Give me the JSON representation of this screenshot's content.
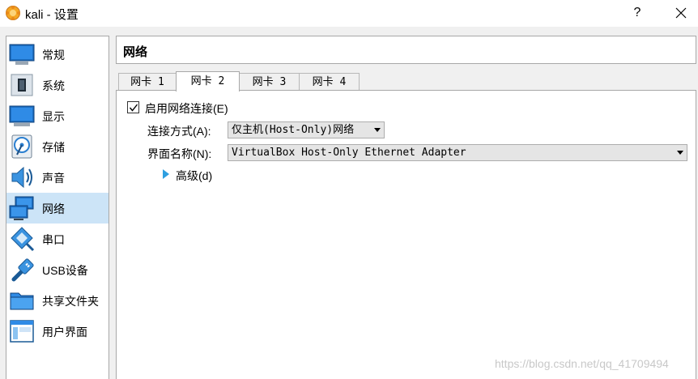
{
  "window": {
    "title": "kali - 设置",
    "help_glyph": "?",
    "app_icon": "virtualbox-icon"
  },
  "sidebar": {
    "items": [
      {
        "label": "常规",
        "icon": "general-monitor-icon",
        "selected": false
      },
      {
        "label": "系统",
        "icon": "system-chip-icon",
        "selected": false
      },
      {
        "label": "显示",
        "icon": "display-monitor-icon",
        "selected": false
      },
      {
        "label": "存储",
        "icon": "storage-disk-icon",
        "selected": false
      },
      {
        "label": "声音",
        "icon": "audio-speaker-icon",
        "selected": false
      },
      {
        "label": "网络",
        "icon": "network-icon",
        "selected": true
      },
      {
        "label": "串口",
        "icon": "serial-port-icon",
        "selected": false
      },
      {
        "label": "USB设备",
        "icon": "usb-icon",
        "selected": false
      },
      {
        "label": "共享文件夹",
        "icon": "shared-folder-icon",
        "selected": false
      },
      {
        "label": "用户界面",
        "icon": "user-interface-icon",
        "selected": false
      }
    ]
  },
  "header": {
    "title": "网络"
  },
  "tabs": [
    {
      "label": "网卡 1",
      "active": false
    },
    {
      "label": "网卡 2",
      "active": true
    },
    {
      "label": "网卡 3",
      "active": false
    },
    {
      "label": "网卡 4",
      "active": false
    }
  ],
  "adapter": {
    "enable_label": "启用网络连接(E)",
    "enabled": true,
    "attached_label": "连接方式(A):",
    "attached_value": "仅主机(Host-Only)网络",
    "name_label": "界面名称(N):",
    "name_value": "VirtualBox Host-Only Ethernet Adapter",
    "advanced_label": "高级(d)"
  },
  "watermark": "https://blog.csdn.net/qq_41709494",
  "colors": {
    "selection": "#cce4f7",
    "accent": "#2e9fe0"
  }
}
